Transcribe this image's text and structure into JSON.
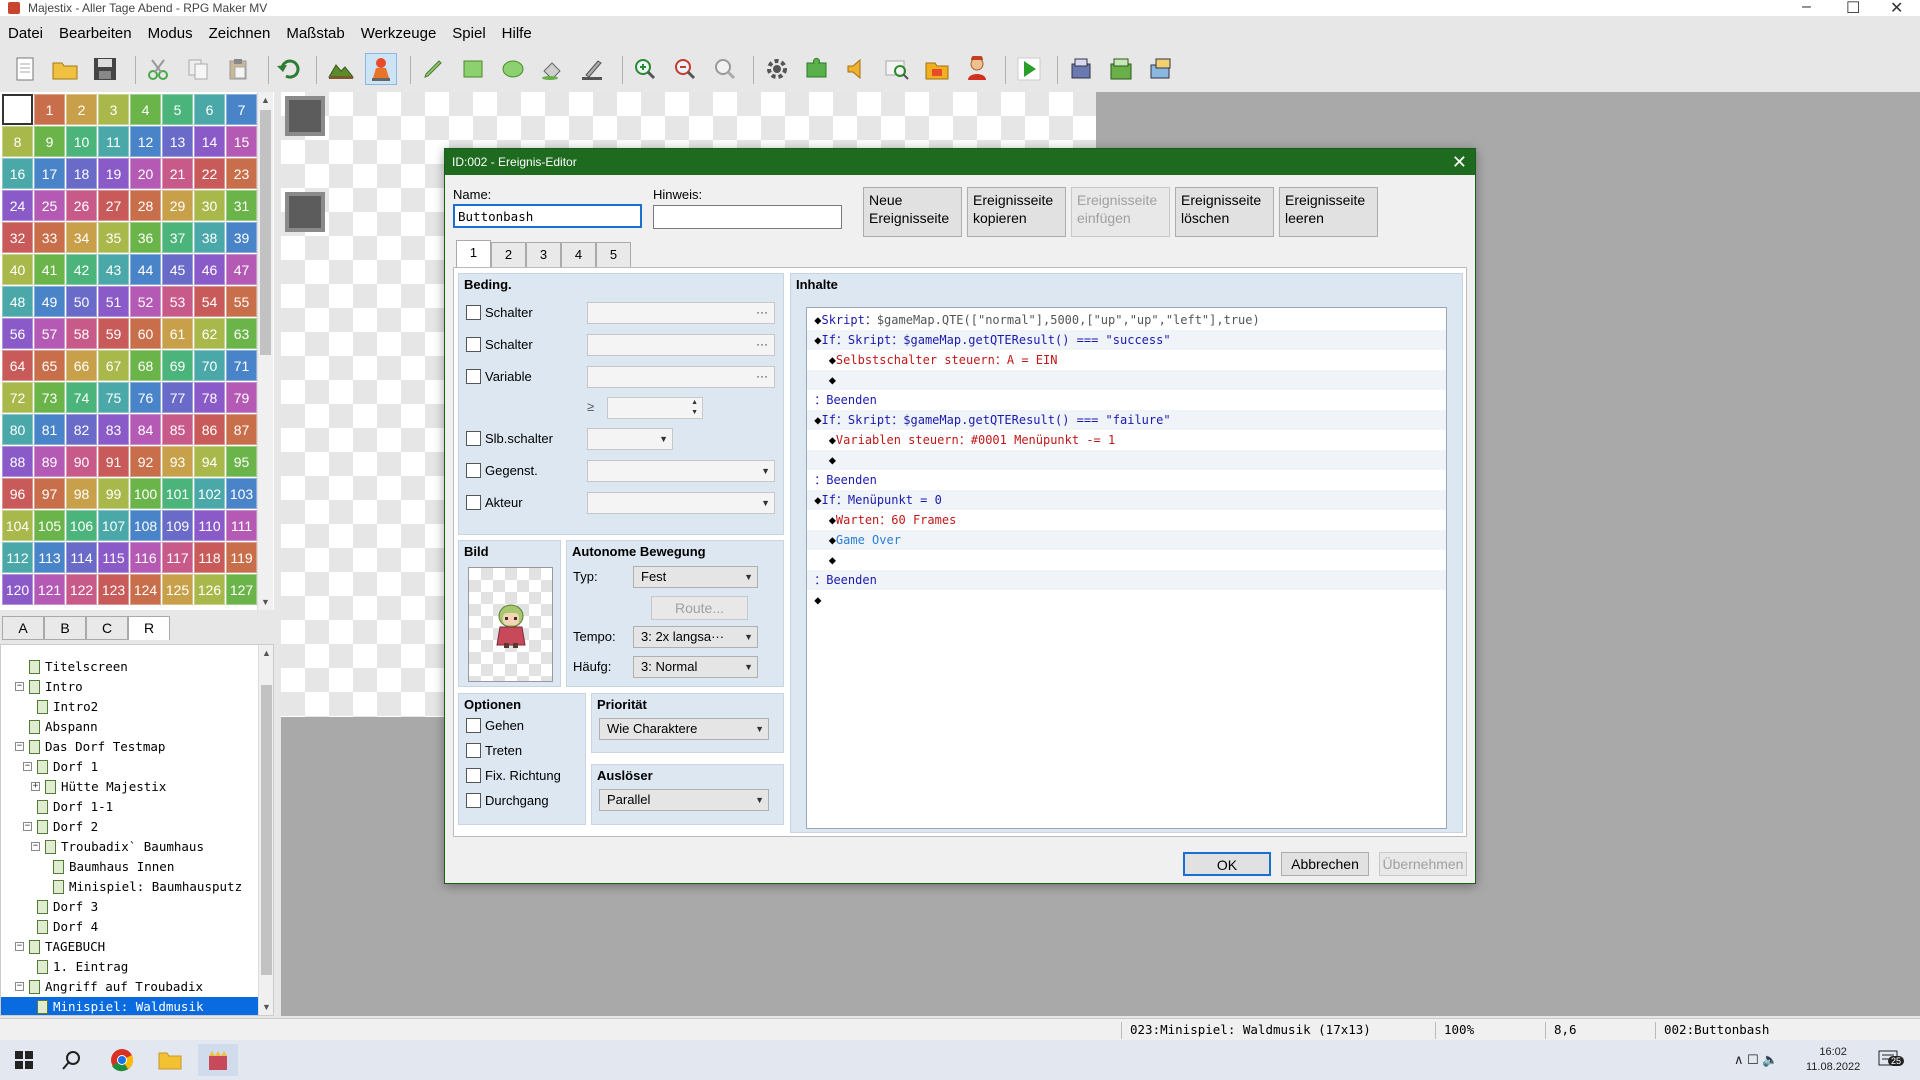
{
  "window": {
    "title": "Majestix - Aller Tage Abend - RPG Maker MV",
    "controls": [
      "–",
      "☐",
      "✕"
    ]
  },
  "menu": [
    "Datei",
    "Bearbeiten",
    "Modus",
    "Zeichnen",
    "Maßstab",
    "Werkzeuge",
    "Spiel",
    "Hilfe"
  ],
  "tileset": {
    "numbers": [
      "1",
      "2",
      "3",
      "4",
      "5",
      "6",
      "7",
      "8",
      "9",
      "10",
      "11",
      "12",
      "13",
      "14",
      "15",
      "16",
      "17",
      "18",
      "19",
      "20",
      "21",
      "22",
      "23",
      "24",
      "25",
      "26",
      "27",
      "28",
      "29",
      "30",
      "31",
      "32",
      "33",
      "34",
      "35",
      "36",
      "37",
      "38",
      "39",
      "40",
      "41",
      "42",
      "43",
      "44",
      "45",
      "46",
      "47",
      "48",
      "49",
      "50",
      "51",
      "52",
      "53",
      "54",
      "55",
      "56",
      "57",
      "58",
      "59",
      "60",
      "61",
      "62",
      "63",
      "64",
      "65",
      "66",
      "67",
      "68",
      "69",
      "70",
      "71",
      "72",
      "73",
      "74",
      "75",
      "76",
      "77",
      "78",
      "79",
      "80",
      "81",
      "82",
      "83",
      "84",
      "85",
      "86",
      "87",
      "88",
      "89",
      "90",
      "91",
      "92",
      "93",
      "94",
      "95",
      "96",
      "97",
      "98",
      "99",
      "100",
      "101",
      "102",
      "103",
      "104",
      "105",
      "106",
      "107",
      "108",
      "109",
      "110",
      "111",
      "112",
      "113",
      "114",
      "115",
      "116",
      "117",
      "118",
      "119",
      "120",
      "121",
      "122",
      "123",
      "124",
      "125",
      "126",
      "127"
    ],
    "tabs": [
      "A",
      "B",
      "C",
      "R"
    ],
    "selected_tab": "R"
  },
  "map_tree": [
    {
      "label": "Titelscreen",
      "depth": 1,
      "exp": ""
    },
    {
      "label": "Intro",
      "depth": 1,
      "exp": "⊟"
    },
    {
      "label": "Intro2",
      "depth": 2,
      "exp": ""
    },
    {
      "label": "Abspann",
      "depth": 1,
      "exp": ""
    },
    {
      "label": "Das Dorf Testmap",
      "depth": 1,
      "exp": "⊟"
    },
    {
      "label": "Dorf 1",
      "depth": 2,
      "exp": "⊟"
    },
    {
      "label": "Hütte Majestix",
      "depth": 3,
      "exp": "⊞"
    },
    {
      "label": "Dorf 1-1",
      "depth": 2,
      "exp": ""
    },
    {
      "label": "Dorf 2",
      "depth": 2,
      "exp": "⊟"
    },
    {
      "label": "Troubadix` Baumhaus",
      "depth": 3,
      "exp": "⊟"
    },
    {
      "label": "Baumhaus Innen",
      "depth": 4,
      "exp": ""
    },
    {
      "label": "Minispiel: Baumhausputz",
      "depth": 4,
      "exp": ""
    },
    {
      "label": "Dorf 3",
      "depth": 2,
      "exp": ""
    },
    {
      "label": "Dorf 4",
      "depth": 2,
      "exp": ""
    },
    {
      "label": "TAGEBUCH",
      "depth": 1,
      "exp": "⊟"
    },
    {
      "label": "1. Eintrag",
      "depth": 2,
      "exp": ""
    },
    {
      "label": "Angriff auf Troubadix",
      "depth": 1,
      "exp": "⊟"
    },
    {
      "label": "Minispiel: Waldmusik",
      "depth": 2,
      "exp": "",
      "selected": true
    }
  ],
  "dialog": {
    "title": "ID:002 - Ereignis-Editor",
    "close": "✕",
    "name_label": "Name:",
    "name_value": "Buttonbash",
    "note_label": "Hinweis:",
    "note_value": "",
    "page_buttons": [
      {
        "line1": "Neue",
        "line2": "Ereignisseite",
        "enabled": true
      },
      {
        "line1": "Ereignisseite",
        "line2": "kopieren",
        "enabled": true
      },
      {
        "line1": "Ereignisseite",
        "line2": "einfügen",
        "enabled": false
      },
      {
        "line1": "Ereignisseite",
        "line2": "löschen",
        "enabled": true
      },
      {
        "line1": "Ereignisseite",
        "line2": "leeren",
        "enabled": true
      }
    ],
    "page_tabs": [
      "1",
      "2",
      "3",
      "4",
      "5"
    ],
    "conditions": {
      "title": "Beding.",
      "rows": [
        "Schalter",
        "Schalter",
        "Variable",
        "Slb.schalter",
        "Gegenst.",
        "Akteur"
      ],
      "ge_symbol": "≥",
      "dots": "···"
    },
    "image": {
      "title": "Bild"
    },
    "movement": {
      "title": "Autonome Bewegung",
      "type_label": "Typ:",
      "type_value": "Fest",
      "route_label": "Route...",
      "speed_label": "Tempo:",
      "speed_value": "3: 2x langsa···",
      "freq_label": "Häufg:",
      "freq_value": "3: Normal"
    },
    "options": {
      "title": "Optionen",
      "items": [
        "Gehen",
        "Treten",
        "Fix. Richtung",
        "Durchgang"
      ]
    },
    "priority": {
      "title": "Priorität",
      "value": "Wie Charaktere"
    },
    "trigger": {
      "title": "Auslöser",
      "value": "Parallel"
    },
    "contents": {
      "title": "Inhalte",
      "lines": [
        "◆Skript：$gameMap.QTE([\"normal\"],5000,[\"up\",\"up\",\"left\"],true)",
        "◆If：Skript：$gameMap.getQTEResult() === \"success\"",
        "  ◆Selbstschalter steuern：A = EIN",
        "  ◆",
        "：Beenden",
        "◆If：Skript：$gameMap.getQTEResult() === \"failure\"",
        "  ◆Variablen steuern：#0001 Menüpunkt -= 1",
        "  ◆",
        "：Beenden",
        "◆If：Menüpunkt = 0",
        "  ◆Warten：60 Frames",
        "  ◆Game Over",
        "  ◆",
        "：Beenden",
        "◆"
      ]
    },
    "ok": "OK",
    "cancel": "Abbrechen",
    "apply": "Übernehmen"
  },
  "status": {
    "map": "023:Minispiel: Waldmusik (17x13)",
    "zoom": "100%",
    "coords": "8,6",
    "event": "002:Buttonbash"
  },
  "taskbar": {
    "time": "16:02",
    "date": "11.08.2022",
    "badge": "25",
    "tray": "∧ ☐ 🔈"
  }
}
